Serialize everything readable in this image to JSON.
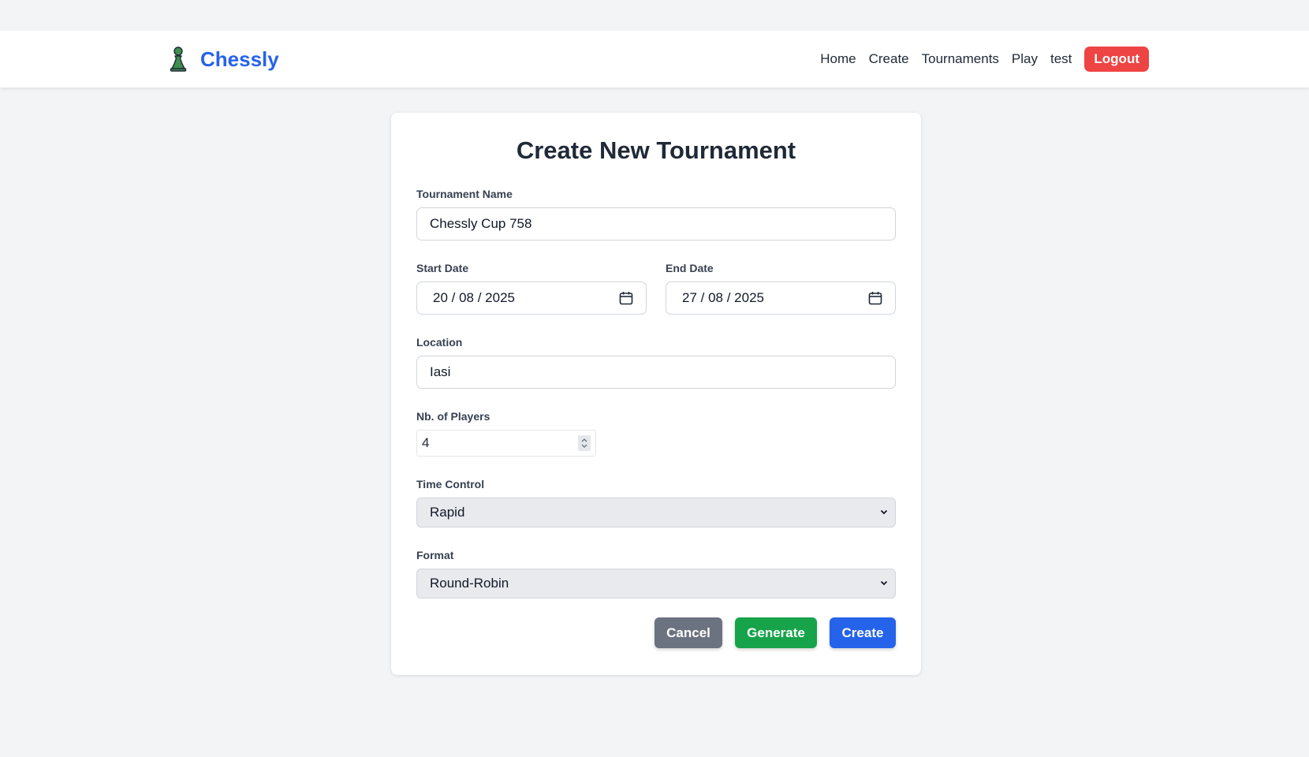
{
  "header": {
    "brand": "Chessly",
    "nav": [
      "Home",
      "Create",
      "Tournaments",
      "Play",
      "test"
    ],
    "logout_label": "Logout",
    "logo_icon": "pawn-icon"
  },
  "form": {
    "title": "Create New Tournament",
    "name_label": "Tournament Name",
    "name_value": "Chessly Cup 758",
    "start_label": "Start Date",
    "start_value": "20 / 08 / 2025",
    "end_label": "End Date",
    "end_value": "27 / 08 / 2025",
    "location_label": "Location",
    "location_value": "Iasi",
    "players_label": "Nb. of Players",
    "players_value": "4",
    "time_label": "Time Control",
    "time_value": "Rapid",
    "format_label": "Format",
    "format_value": "Round-Robin"
  },
  "buttons": {
    "cancel": "Cancel",
    "generate": "Generate",
    "create": "Create"
  },
  "colors": {
    "brand": "#2563eb",
    "logout": "#ef4444",
    "cancel": "#6b7280",
    "generate": "#16a34a",
    "create": "#2563eb"
  }
}
